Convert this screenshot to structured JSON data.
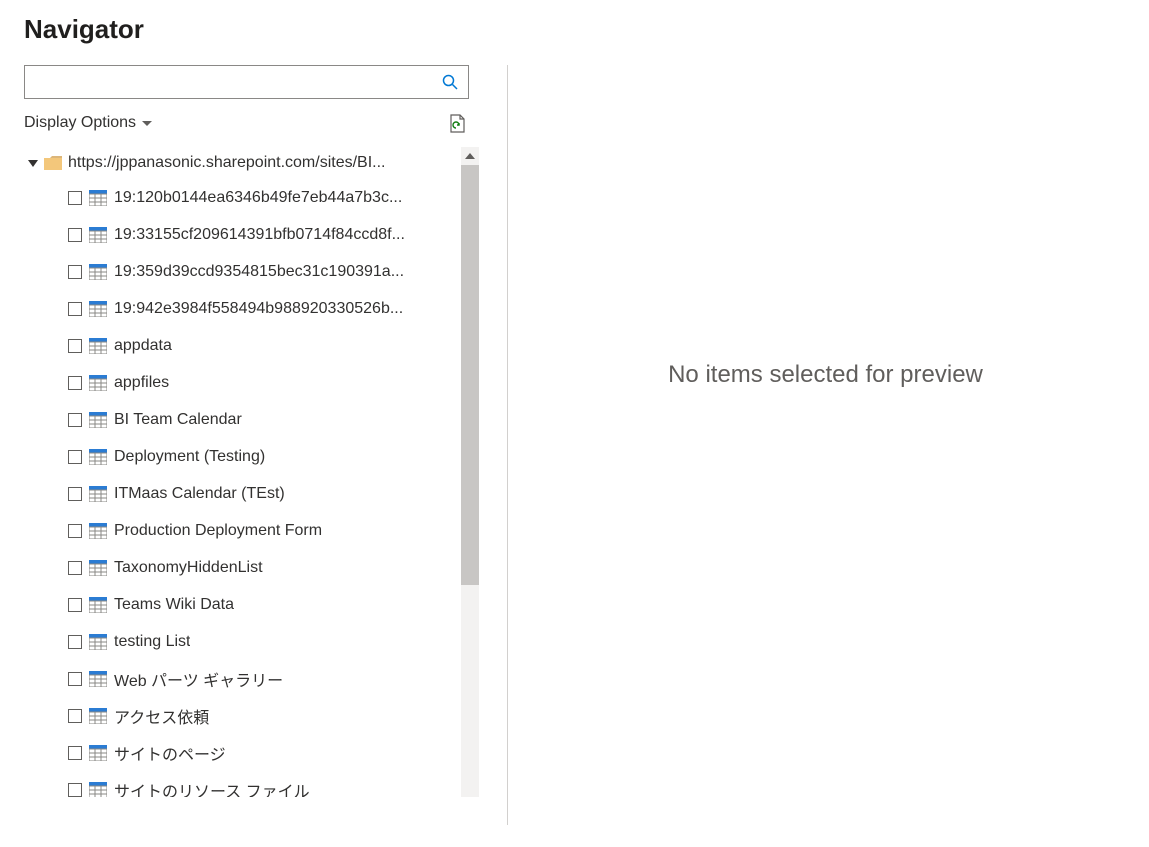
{
  "title": "Navigator",
  "search": {
    "value": "",
    "placeholder": ""
  },
  "display_options_label": "Display Options",
  "root": {
    "label": "https://jppanasonic.sharepoint.com/sites/BI..."
  },
  "items": [
    {
      "label": "19:120b0144ea6346b49fe7eb44a7b3c..."
    },
    {
      "label": "19:33155cf209614391bfb0714f84ccd8f..."
    },
    {
      "label": "19:359d39ccd9354815bec31c190391a..."
    },
    {
      "label": "19:942e3984f558494b988920330526b..."
    },
    {
      "label": "appdata"
    },
    {
      "label": "appfiles"
    },
    {
      "label": "BI Team Calendar"
    },
    {
      "label": "Deployment (Testing)"
    },
    {
      "label": "ITMaas Calendar (TEst)"
    },
    {
      "label": "Production Deployment Form"
    },
    {
      "label": "TaxonomyHiddenList"
    },
    {
      "label": "Teams Wiki Data"
    },
    {
      "label": "testing List"
    },
    {
      "label": "Web パーツ ギャラリー"
    },
    {
      "label": "アクセス依頼"
    },
    {
      "label": "サイトのページ"
    },
    {
      "label": "サイトのリソース ファイル"
    }
  ],
  "preview_message": "No items selected for preview"
}
